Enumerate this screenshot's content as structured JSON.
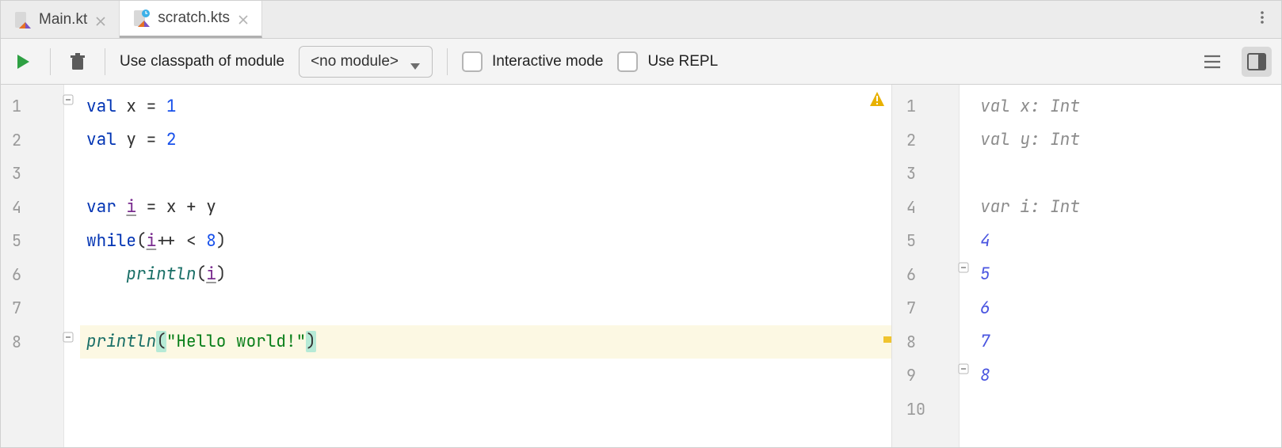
{
  "tabs": [
    {
      "label": "Main.kt",
      "active": false
    },
    {
      "label": "scratch.kts",
      "active": true
    }
  ],
  "toolbar": {
    "classpath_label": "Use classpath of module",
    "dropdown_value": "<no module>",
    "interactive_label": "Interactive mode",
    "repl_label": "Use REPL"
  },
  "editor": {
    "line_numbers": [
      "1",
      "2",
      "3",
      "4",
      "5",
      "6",
      "7",
      "8"
    ],
    "lines": [
      {
        "tokens": [
          {
            "c": "kw",
            "t": "val "
          },
          {
            "c": "op",
            "t": "x = "
          },
          {
            "c": "num",
            "t": "1"
          }
        ]
      },
      {
        "tokens": [
          {
            "c": "kw",
            "t": "val "
          },
          {
            "c": "op",
            "t": "y = "
          },
          {
            "c": "num",
            "t": "2"
          }
        ]
      },
      {
        "tokens": []
      },
      {
        "tokens": [
          {
            "c": "kw",
            "t": "var "
          },
          {
            "c": "id-under",
            "t": "i"
          },
          {
            "c": "op",
            "t": " = x + y"
          }
        ]
      },
      {
        "tokens": [
          {
            "c": "kw",
            "t": "while"
          },
          {
            "c": "op",
            "t": "("
          },
          {
            "c": "id-under",
            "t": "i"
          },
          {
            "c": "op",
            "t": "++ < "
          },
          {
            "c": "num",
            "t": "8"
          },
          {
            "c": "op",
            "t": ")"
          }
        ]
      },
      {
        "tokens": [
          {
            "c": "op",
            "t": "    "
          },
          {
            "c": "fn",
            "t": "println"
          },
          {
            "c": "op",
            "t": "("
          },
          {
            "c": "id-under",
            "t": "i"
          },
          {
            "c": "op",
            "t": ")"
          }
        ]
      },
      {
        "tokens": []
      },
      {
        "hl": true,
        "tokens": [
          {
            "c": "fn",
            "t": "println"
          },
          {
            "c": "paren-match",
            "t": "("
          },
          {
            "c": "str",
            "t": "\"Hello world!\""
          },
          {
            "c": "paren-match",
            "t": ")"
          }
        ]
      }
    ]
  },
  "output": {
    "line_numbers": [
      "1",
      "2",
      "3",
      "4",
      "5",
      "6",
      "7",
      "8",
      "9",
      "10"
    ],
    "lines": [
      {
        "kind": "type",
        "text": "val x: Int"
      },
      {
        "kind": "type",
        "text": "val y: Int"
      },
      {
        "kind": "blank",
        "text": ""
      },
      {
        "kind": "type",
        "text": "var i: Int"
      },
      {
        "kind": "val",
        "text": "4"
      },
      {
        "kind": "val",
        "text": "5",
        "fold": true
      },
      {
        "kind": "val",
        "text": "6"
      },
      {
        "kind": "val",
        "text": "7"
      },
      {
        "kind": "val",
        "text": "8",
        "fold": true
      },
      {
        "kind": "blank",
        "text": ""
      }
    ]
  }
}
